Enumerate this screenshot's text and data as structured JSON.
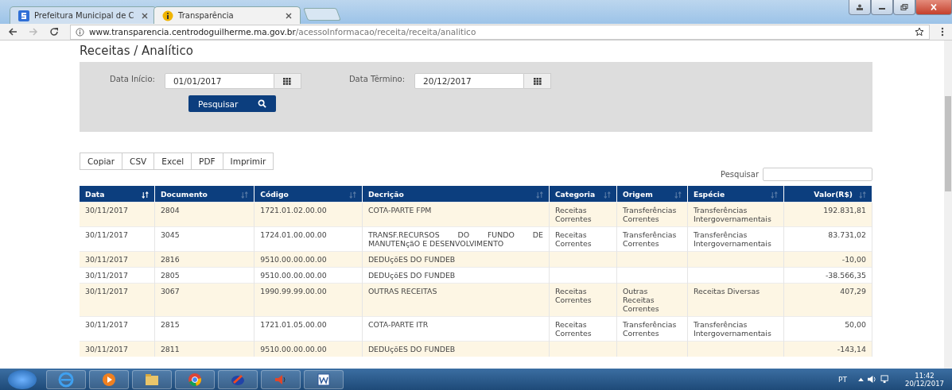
{
  "browser": {
    "tabs": [
      {
        "title": "Prefeitura Municipal de C",
        "selected": false
      },
      {
        "title": "Transparência",
        "selected": true
      }
    ],
    "url_host": "www.transparencia.centrodoguilherme.ma.gov.br",
    "url_path": "/acessoInformacao/receita/receita/analitico"
  },
  "page": {
    "title": "Receitas / Analítico",
    "filters": [
      {
        "label": "Data Início:",
        "value": "01/01/2017"
      },
      {
        "label": "Data Têrmino:",
        "value": "20/12/2017"
      }
    ],
    "search_button": "Pesquisar",
    "export_buttons": [
      "Copiar",
      "CSV",
      "Excel",
      "PDF",
      "Imprimir"
    ],
    "table_search_label": "Pesquisar",
    "table": {
      "columns": [
        {
          "label": "Data",
          "sorted": true
        },
        {
          "label": "Documento",
          "sorted": false
        },
        {
          "label": "Código",
          "sorted": false
        },
        {
          "label": "Decrição",
          "sorted": false
        },
        {
          "label": "Categoria",
          "sorted": false
        },
        {
          "label": "Origem",
          "sorted": false
        },
        {
          "label": "Espécie",
          "sorted": false
        },
        {
          "label": "Valor(R$)",
          "sorted": false
        }
      ],
      "rows": [
        [
          "30/11/2017",
          "2804",
          "1721.01.02.00.00",
          "COTA-PARTE FPM",
          "Receitas Correntes",
          "Transferências Correntes",
          "Transferências Intergovernamentais",
          "192.831,81"
        ],
        [
          "30/11/2017",
          "3045",
          "1724.01.00.00.00",
          "TRANSF.RECURSOS DO FUNDO DE MANUTENçãO E DESENVOLVIMENTO",
          "Receitas Correntes",
          "Transferências Correntes",
          "Transferências Intergovernamentais",
          "83.731,02"
        ],
        [
          "30/11/2017",
          "2816",
          "9510.00.00.00.00",
          "DEDUçõES DO FUNDEB",
          "",
          "",
          "",
          "-10,00"
        ],
        [
          "30/11/2017",
          "2805",
          "9510.00.00.00.00",
          "DEDUçõES DO FUNDEB",
          "",
          "",
          "",
          "-38.566,35"
        ],
        [
          "30/11/2017",
          "3067",
          "1990.99.99.00.00",
          "OUTRAS RECEITAS",
          "Receitas Correntes",
          "Outras Receitas Correntes",
          "Receitas Diversas",
          "407,29"
        ],
        [
          "30/11/2017",
          "2815",
          "1721.01.05.00.00",
          "COTA-PARTE ITR",
          "Receitas Correntes",
          "Transferências Correntes",
          "Transferências Intergovernamentais",
          "50,00"
        ],
        [
          "30/11/2017",
          "2811",
          "9510.00.00.00.00",
          "DEDUçõES DO FUNDEB",
          "",
          "",
          "",
          "-143,14"
        ]
      ]
    }
  },
  "taskbar": {
    "language": "PT",
    "time": "11:42",
    "date": "20/12/2017"
  }
}
